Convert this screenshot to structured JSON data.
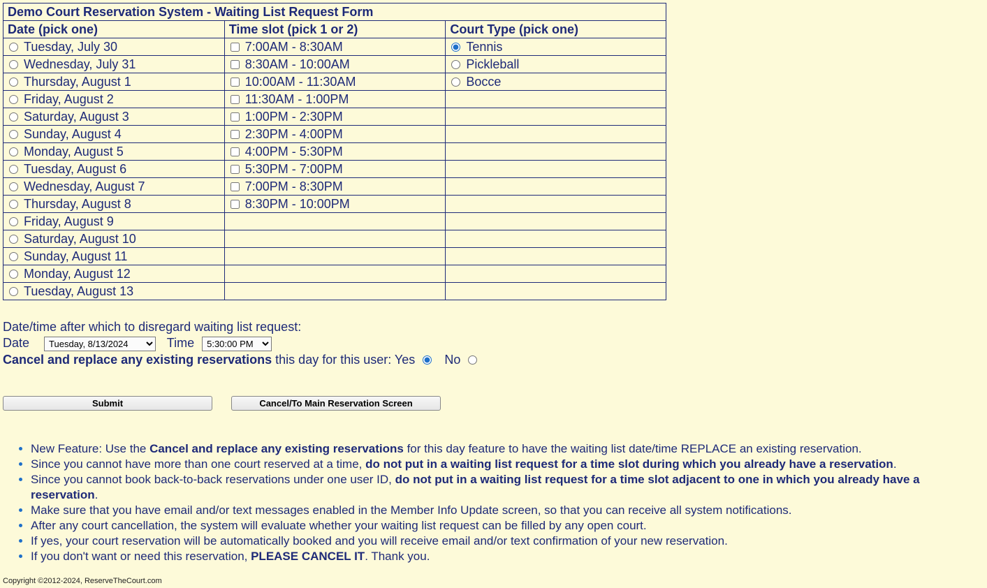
{
  "title": "Demo Court Reservation System - Waiting List Request Form",
  "headers": {
    "date": "Date (pick one)",
    "time": "Time slot (pick 1 or 2)",
    "court": "Court Type (pick one)"
  },
  "dates": [
    "Tuesday, July 30",
    "Wednesday, July 31",
    "Thursday, August 1",
    "Friday, August 2",
    "Saturday, August 3",
    "Sunday, August 4",
    "Monday, August 5",
    "Tuesday, August 6",
    "Wednesday, August 7",
    "Thursday, August 8",
    "Friday, August 9",
    "Saturday, August 10",
    "Sunday, August 11",
    "Monday, August 12",
    "Tuesday, August 13"
  ],
  "timeslots": [
    "7:00AM - 8:30AM",
    "8:30AM - 10:00AM",
    "10:00AM - 11:30AM",
    "11:30AM - 1:00PM",
    "1:00PM - 2:30PM",
    "2:30PM - 4:00PM",
    "4:00PM - 5:30PM",
    "5:30PM - 7:00PM",
    "7:00PM - 8:30PM",
    "8:30PM - 10:00PM"
  ],
  "courts": [
    "Tennis",
    "Pickleball",
    "Bocce"
  ],
  "court_selected_index": 0,
  "disregard": {
    "prompt": "Date/time after which to disregard waiting list request:",
    "date_label": "Date",
    "time_label": "Time",
    "date_value": "Tuesday, 8/13/2024",
    "time_value": "5:30:00 PM"
  },
  "cancel_replace": {
    "bold": "Cancel and replace any existing reservations",
    "rest": " this day for this user: ",
    "yes": "Yes",
    "no": "No",
    "selected": "yes"
  },
  "buttons": {
    "submit": "Submit",
    "cancel": "Cancel/To Main Reservation Screen"
  },
  "notes": [
    {
      "segments": [
        {
          "t": "New Feature: Use the "
        },
        {
          "t": "Cancel and replace any existing reservations",
          "b": true
        },
        {
          "t": " for this day feature to have the waiting list date/time REPLACE an existing reservation."
        }
      ]
    },
    {
      "segments": [
        {
          "t": "Since you cannot have more than one court reserved at a time, "
        },
        {
          "t": "do not put in a waiting list request for a time slot during which you already have a reservation",
          "b": true
        },
        {
          "t": "."
        }
      ]
    },
    {
      "segments": [
        {
          "t": "Since you cannot book back-to-back reservations under one user ID, "
        },
        {
          "t": "do not put in a waiting list request for a time slot adjacent to one in which you already have a reservation",
          "b": true
        },
        {
          "t": "."
        }
      ]
    },
    {
      "segments": [
        {
          "t": "Make sure that you have email and/or text messages enabled in the Member Info Update screen, so that you can receive all system notifications."
        }
      ]
    },
    {
      "segments": [
        {
          "t": "After any court cancellation, the system will evaluate whether your waiting list request can be filled by any open court."
        }
      ]
    },
    {
      "segments": [
        {
          "t": "If yes, your court reservation will be automatically booked and you will receive email and/or text confirmation of your new reservation."
        }
      ]
    },
    {
      "segments": [
        {
          "t": "If you don't want or need this reservation, "
        },
        {
          "t": "PLEASE CANCEL IT",
          "b": true
        },
        {
          "t": ". Thank you."
        }
      ]
    }
  ],
  "footer": "Copyright ©2012-2024, ReserveTheCourt.com"
}
